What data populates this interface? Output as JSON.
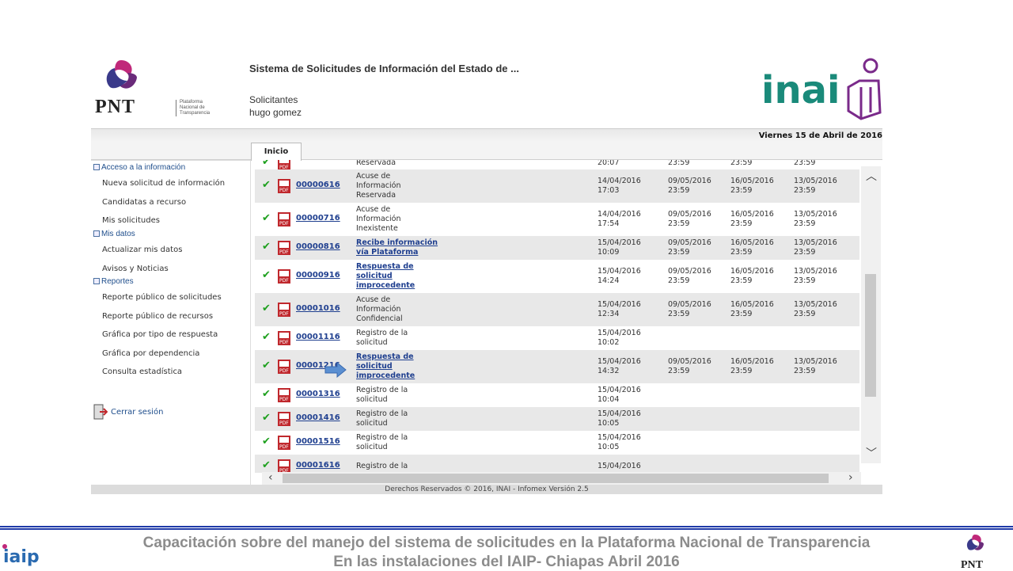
{
  "header": {
    "system_title": "Sistema de Solicitudes de Información del Estado de ...",
    "role": "Solicitantes",
    "user": "hugo gomez",
    "pnt_word": "PNT",
    "pnt_sub": [
      "Plataforma",
      "Nacional de",
      "Transparencia"
    ],
    "inai_word": "inai",
    "date": "Viernes 15 de Abril de 2016"
  },
  "tab": {
    "label": "Inicio"
  },
  "sidebar": {
    "sections": [
      {
        "label": "Acceso a la información",
        "items": [
          "Nueva solicitud de información",
          "Candidatas a recurso",
          "Mis solicitudes"
        ]
      },
      {
        "label": "Mis datos",
        "items": [
          "Actualizar mis datos",
          "Avisos y Noticias"
        ]
      },
      {
        "label": "Reportes",
        "items": [
          "Reporte público de solicitudes",
          "Reporte público de recursos",
          "Gráfica por tipo de respuesta",
          "Gráfica por dependencia",
          "Consulta estadística"
        ]
      }
    ],
    "logout": "Cerrar sesión"
  },
  "table": {
    "rows": [
      {
        "folio": "",
        "status": [
          "Reservada"
        ],
        "link": false,
        "d1": [
          "20:07"
        ],
        "d2": [
          "23:59"
        ],
        "d3": [
          "23:59"
        ],
        "d4": [
          "23:59"
        ],
        "partial_top": true
      },
      {
        "folio": "00000616",
        "status": [
          "Acuse de",
          "Información",
          "Reservada"
        ],
        "link": false,
        "d1": [
          "14/04/2016",
          "17:03"
        ],
        "d2": [
          "09/05/2016",
          "23:59"
        ],
        "d3": [
          "16/05/2016",
          "23:59"
        ],
        "d4": [
          "13/05/2016",
          "23:59"
        ]
      },
      {
        "folio": "00000716",
        "status": [
          "Acuse de",
          "Información",
          "Inexistente"
        ],
        "link": false,
        "d1": [
          "14/04/2016",
          "17:54"
        ],
        "d2": [
          "09/05/2016",
          "23:59"
        ],
        "d3": [
          "16/05/2016",
          "23:59"
        ],
        "d4": [
          "13/05/2016",
          "23:59"
        ]
      },
      {
        "folio": "00000816",
        "status": [
          "Recibe información",
          "vía Plataforma"
        ],
        "link": true,
        "d1": [
          "15/04/2016",
          "10:09"
        ],
        "d2": [
          "09/05/2016",
          "23:59"
        ],
        "d3": [
          "16/05/2016",
          "23:59"
        ],
        "d4": [
          "13/05/2016",
          "23:59"
        ]
      },
      {
        "folio": "00000916",
        "status": [
          "Respuesta de",
          "solicitud",
          "improcedente"
        ],
        "link": true,
        "d1": [
          "15/04/2016",
          "14:24"
        ],
        "d2": [
          "09/05/2016",
          "23:59"
        ],
        "d3": [
          "16/05/2016",
          "23:59"
        ],
        "d4": [
          "13/05/2016",
          "23:59"
        ]
      },
      {
        "folio": "00001016",
        "status": [
          "Acuse de",
          "Información",
          "Confidencial"
        ],
        "link": false,
        "d1": [
          "15/04/2016",
          "12:34"
        ],
        "d2": [
          "09/05/2016",
          "23:59"
        ],
        "d3": [
          "16/05/2016",
          "23:59"
        ],
        "d4": [
          "13/05/2016",
          "23:59"
        ]
      },
      {
        "folio": "00001116",
        "status": [
          "Registro de la",
          "solicitud"
        ],
        "link": false,
        "d1": [
          "15/04/2016",
          "10:02"
        ],
        "d2": [],
        "d3": [],
        "d4": []
      },
      {
        "folio": "00001216",
        "status": [
          "Respuesta de",
          "solicitud",
          "improcedente"
        ],
        "link": true,
        "d1": [
          "15/04/2016",
          "14:32"
        ],
        "d2": [
          "09/05/2016",
          "23:59"
        ],
        "d3": [
          "16/05/2016",
          "23:59"
        ],
        "d4": [
          "13/05/2016",
          "23:59"
        ]
      },
      {
        "folio": "00001316",
        "status": [
          "Registro de la",
          "solicitud"
        ],
        "link": false,
        "d1": [
          "15/04/2016",
          "10:04"
        ],
        "d2": [],
        "d3": [],
        "d4": []
      },
      {
        "folio": "00001416",
        "status": [
          "Registro de la",
          "solicitud"
        ],
        "link": false,
        "d1": [
          "15/04/2016",
          "10:05"
        ],
        "d2": [],
        "d3": [],
        "d4": []
      },
      {
        "folio": "00001516",
        "status": [
          "Registro de la",
          "solicitud"
        ],
        "link": false,
        "d1": [
          "15/04/2016",
          "10:05"
        ],
        "d2": [],
        "d3": [],
        "d4": []
      },
      {
        "folio": "00001616",
        "status": [
          "Registro de la"
        ],
        "link": false,
        "d1": [
          "15/04/2016"
        ],
        "d2": [],
        "d3": [],
        "d4": []
      }
    ]
  },
  "footer": {
    "text": "Derechos Reservados © 2016, INAI - Infomex Versión 2.5"
  },
  "slide": {
    "caption_line1": "Capacitación sobre del manejo del sistema de solicitudes en la Plataforma Nacional de Transparencia",
    "caption_line2": "En las instalaciones del IAIP- Chiapas    Abril 2016",
    "iaip_word": "iaip",
    "pnt_word": "PNT"
  },
  "colors": {
    "accent_blue": "#1f3aa8",
    "pnt_purple": "#6a2b7a",
    "inai_teal": "#1a8a7a",
    "check_green": "#1ea01e",
    "pdf_red": "#c0282d"
  }
}
